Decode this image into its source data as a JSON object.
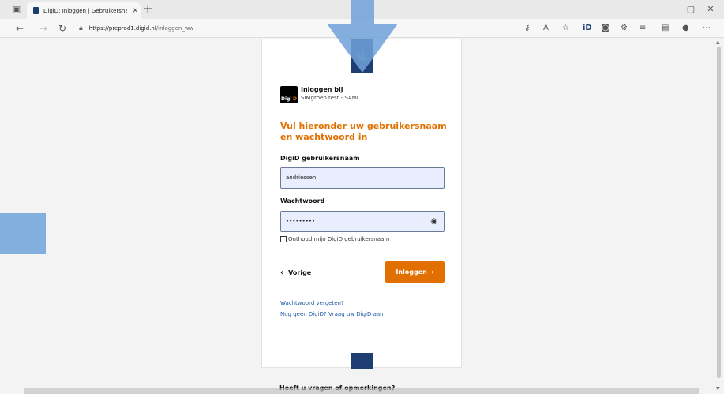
{
  "browser": {
    "tab_title": "DigiD: Inloggen | Gebruikersnaam",
    "tab_close": "×",
    "new_tab": "+",
    "win_minimize": "−",
    "win_maximize": "▢",
    "win_close": "✕",
    "url_host": "https://preprod1.digid.nl",
    "url_path": "/inloggen_ww"
  },
  "login": {
    "inloggen_bij": "Inloggen bij",
    "service": "SIMgroep test - SAML",
    "logo_text": "Digi",
    "logo_d": "D",
    "heading": "Vul hieronder uw gebruikersnaam en wachtwoord in",
    "username_label": "DigiD gebruikersnaam",
    "username_value": "andriessen",
    "password_label": "Wachtwoord",
    "password_value": "•••••••••",
    "remember_label": "Onthoud mijn DigiD gebruikersnaam",
    "back_label": "Vorige",
    "login_label": "Inloggen",
    "forgot_link": "Wachtwoord vergeten?",
    "apply_link": "Nog geen DigiD? Vraag uw DigiD aan",
    "questions": "Heeft u vragen of opmerkingen?"
  },
  "colors": {
    "accent": "#e17000",
    "crest_blue": "#1f3f74",
    "link": "#1f5aa6",
    "overlay_blue": "#6fa2d9"
  }
}
